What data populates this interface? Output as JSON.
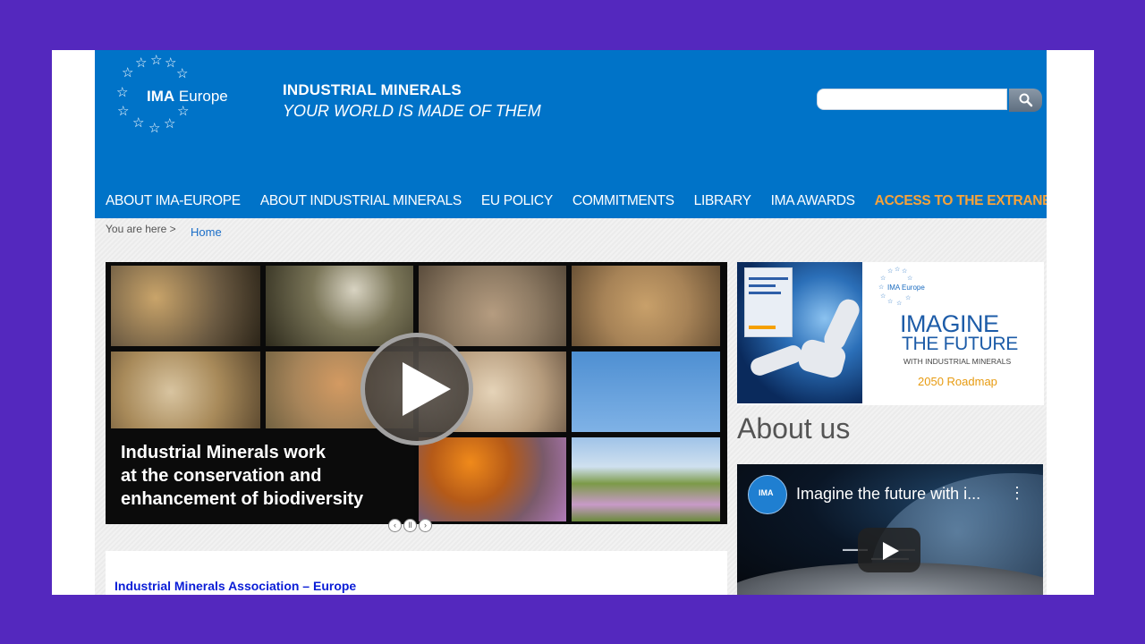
{
  "header": {
    "logo_prefix": "IMA",
    "logo_suffix": "Europe",
    "tagline_line1": "INDUSTRIAL MINERALS",
    "tagline_line2": "YOUR WORLD IS MADE OF THEM",
    "search_placeholder": "",
    "colors": {
      "header_bg": "#0073c8",
      "extranet": "#f7a33a"
    }
  },
  "nav": {
    "items": [
      {
        "label": "ABOUT IMA-EUROPE"
      },
      {
        "label": "ABOUT INDUSTRIAL MINERALS"
      },
      {
        "label": "EU POLICY"
      },
      {
        "label": "COMMITMENTS"
      },
      {
        "label": "LIBRARY"
      },
      {
        "label": "IMA AWARDS"
      },
      {
        "label": "ACCESS TO THE EXTRANET"
      }
    ]
  },
  "breadcrumb": {
    "prefix": "You are here >",
    "home": "Home"
  },
  "slider": {
    "caption_line1": "Industrial Minerals work",
    "caption_line2": "at the conservation and",
    "caption_line3": "enhancement of biodiversity",
    "controls": {
      "prev": "‹",
      "pause": "ll",
      "next": "›"
    }
  },
  "content": {
    "title": "Industrial Minerals Association – Europe"
  },
  "promo": {
    "logo_text": "IMA Europe",
    "line1": "IMAGINE",
    "line2": "THE FUTURE",
    "line3": "WITH INDUSTRIAL MINERALS",
    "line4": "2050 Roadmap"
  },
  "about": {
    "title": "About us",
    "video_title": "Imagine the future with i...",
    "channel_badge": "IMA",
    "menu_glyph": "⋮"
  }
}
